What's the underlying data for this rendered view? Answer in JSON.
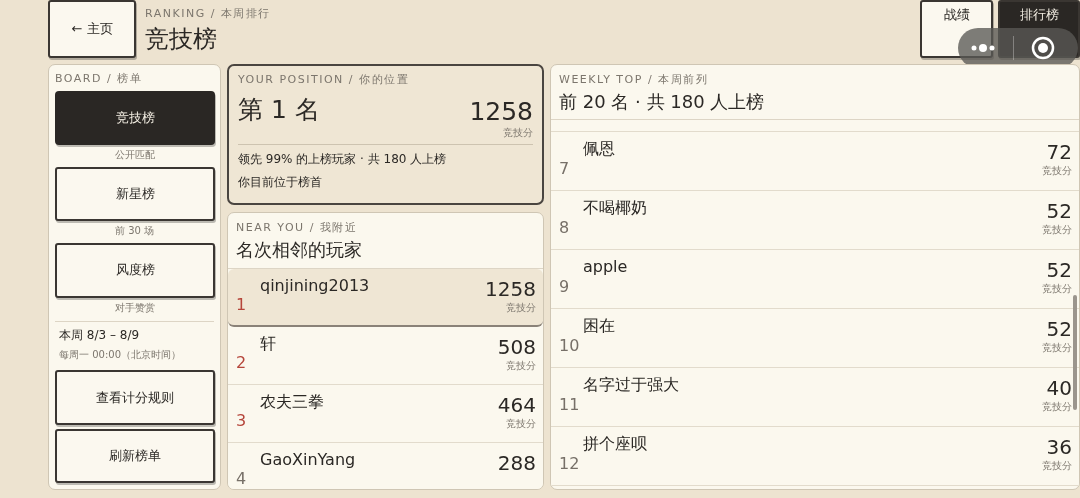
{
  "header": {
    "back_button": "← 主页",
    "eyebrow": "RANKING / 本周排行",
    "title": "竞技榜"
  },
  "top_tabs": [
    {
      "label": "战绩",
      "selected": false
    },
    {
      "label": "排行榜",
      "selected": true
    }
  ],
  "board": {
    "eyebrow": "BOARD / 榜单",
    "items": [
      {
        "label": "竞技榜",
        "caption": "公开匹配",
        "selected": true
      },
      {
        "label": "新星榜",
        "caption": "前 30 场",
        "selected": false
      },
      {
        "label": "风度榜",
        "caption": "对手赞赏",
        "selected": false
      }
    ],
    "week": "本周 8/3 – 8/9",
    "reset": "每周一 00:00（北京时间）",
    "buttons": [
      "查看计分规则",
      "刷新榜单"
    ]
  },
  "position": {
    "eyebrow": "YOUR POSITION / 你的位置",
    "rank": "第 1 名",
    "score": "1258",
    "unit": "竞技分",
    "summary": "领先 99% 的上榜玩家 · 共 180 人上榜",
    "note": "你目前位于榜首"
  },
  "near": {
    "eyebrow": "NEAR YOU / 我附近",
    "title": "名次相邻的玩家",
    "rows": [
      {
        "rank": "1",
        "name": "qinjining2013",
        "score": "1258",
        "unit": "竞技分",
        "selected": true,
        "color": "#b5453a"
      },
      {
        "rank": "2",
        "name": "轩",
        "score": "508",
        "unit": "竞技分",
        "selected": false,
        "color": "#b5453a"
      },
      {
        "rank": "3",
        "name": "农夫三拳",
        "score": "464",
        "unit": "竞技分",
        "selected": false,
        "color": "#b5453a"
      },
      {
        "rank": "4",
        "name": "GaoXinYang",
        "score": "288",
        "selected": false,
        "color": "#777068"
      }
    ]
  },
  "weekly": {
    "eyebrow": "WEEKLY TOP / 本周前列",
    "title": "前 20 名 · 共 180 人上榜",
    "rows": [
      {
        "rank": "7",
        "name": "佩恩",
        "score": "72",
        "unit": "竞技分"
      },
      {
        "rank": "8",
        "name": "不喝椰奶",
        "score": "52",
        "unit": "竞技分"
      },
      {
        "rank": "9",
        "name": "apple",
        "score": "52",
        "unit": "竞技分"
      },
      {
        "rank": "10",
        "name": "困在",
        "score": "52",
        "unit": "竞技分"
      },
      {
        "rank": "11",
        "name": "名字过于强大",
        "score": "40",
        "unit": "竞技分"
      },
      {
        "rank": "12",
        "name": "拼个座呗",
        "score": "36",
        "unit": "竞技分"
      }
    ]
  }
}
